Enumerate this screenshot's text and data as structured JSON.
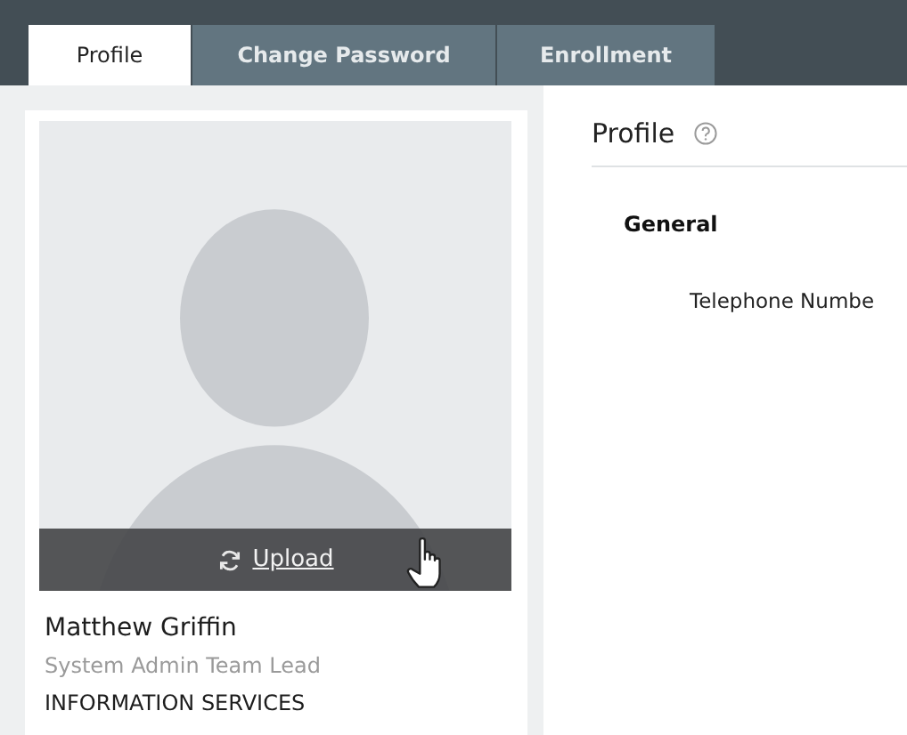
{
  "tabs": [
    {
      "label": "Profile",
      "selected": true
    },
    {
      "label": "Change Password",
      "selected": false
    },
    {
      "label": "Enrollment",
      "selected": false
    }
  ],
  "profile_card": {
    "upload_label": "Upload",
    "name": "Matthew Griffin",
    "job_title": "System Admin Team Lead",
    "department": "INFORMATION SERVICES"
  },
  "content": {
    "heading": "Profile",
    "section": "General",
    "field_label": "Telephone Numbe"
  }
}
